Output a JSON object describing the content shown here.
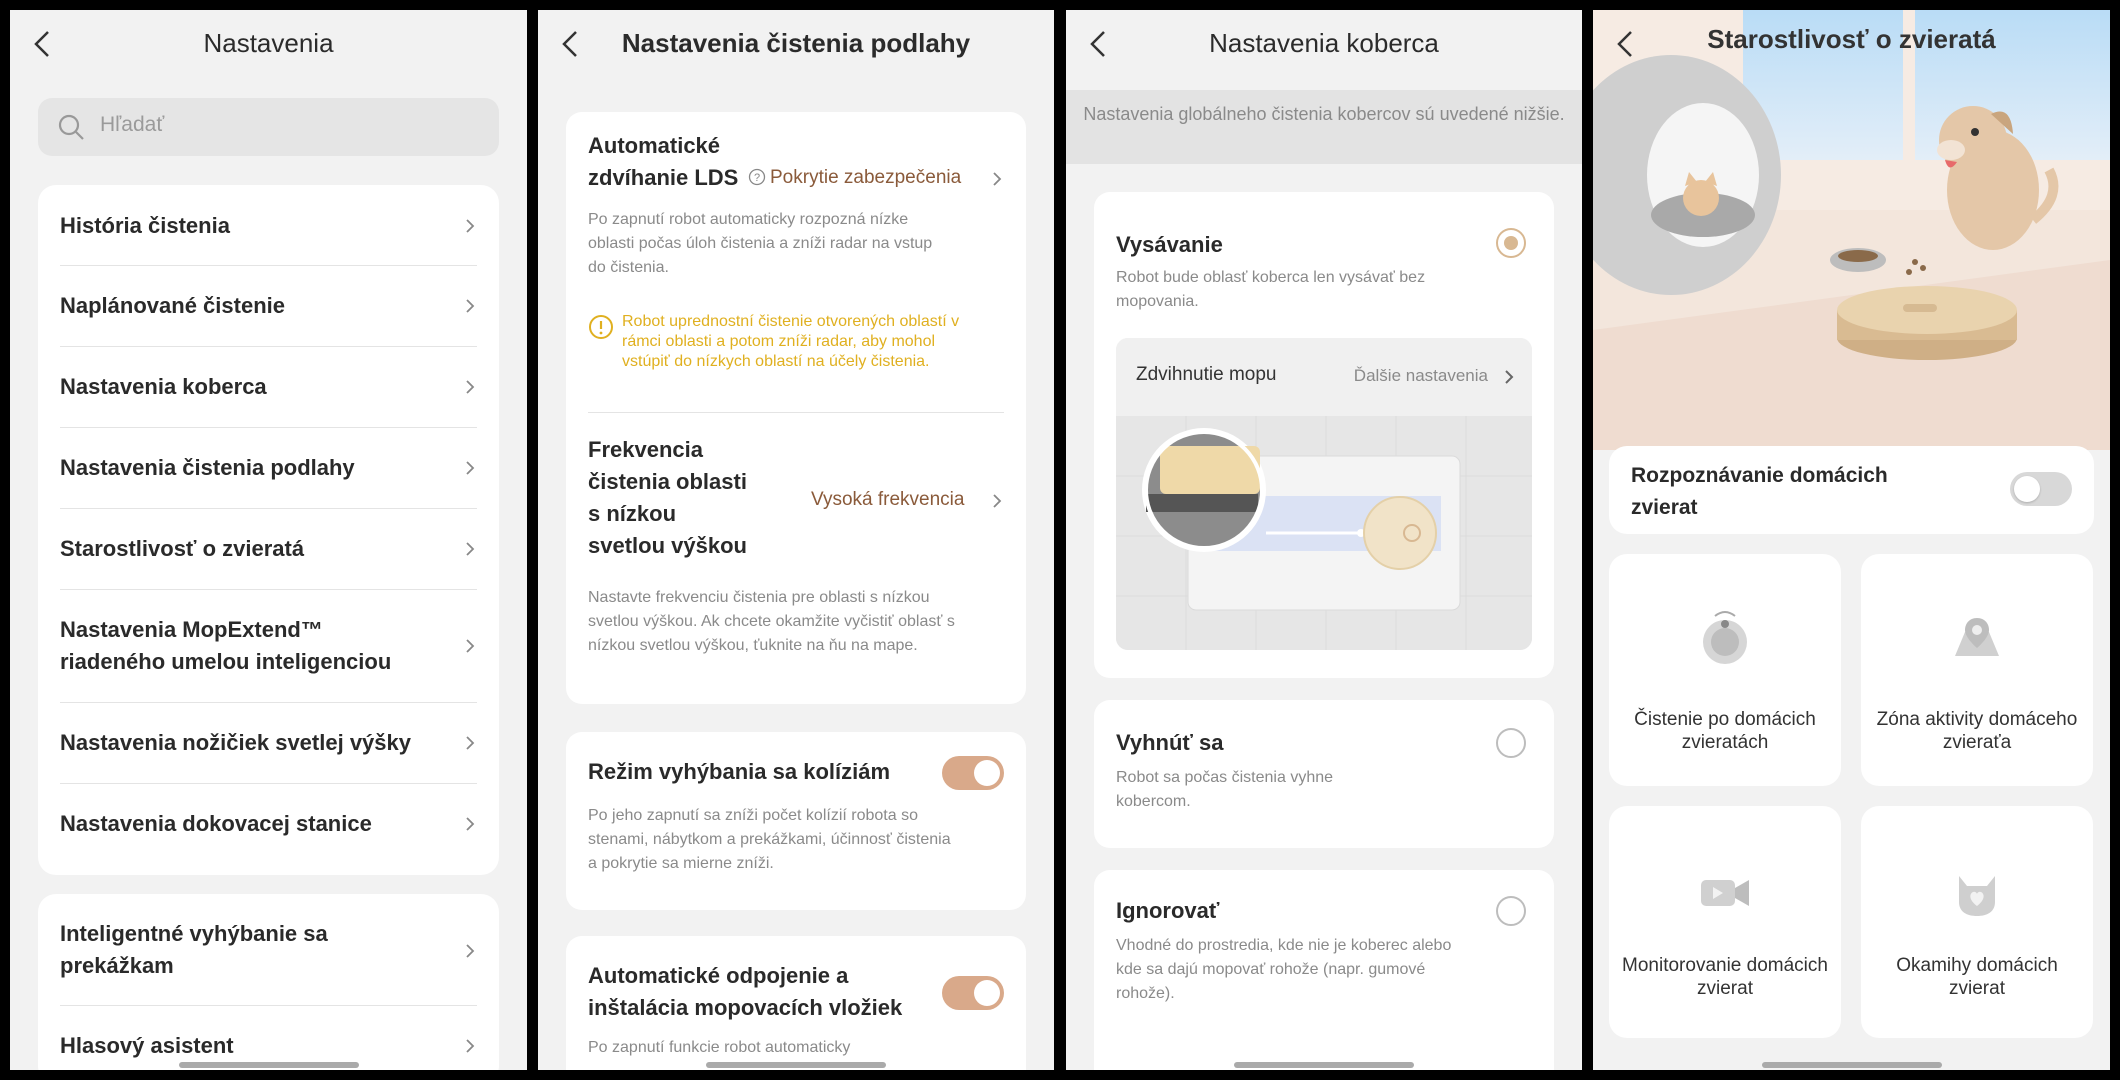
{
  "screen1": {
    "title": "Nastavenia",
    "search_placeholder": "Hľadať",
    "items": [
      {
        "label": "História čistenia"
      },
      {
        "label": "Naplánované čistenie"
      },
      {
        "label": "Nastavenia koberca"
      },
      {
        "label": "Nastavenia čistenia podlahy"
      },
      {
        "label": "Starostlivosť o zvieratá"
      },
      {
        "label": "Nastavenia MopExtend™ riadeného umelou inteligenciou"
      },
      {
        "label": "Nastavenia nožičiek svetlej výšky"
      },
      {
        "label": "Nastavenia dokovacej stanice"
      }
    ],
    "items2": [
      {
        "label": "Inteligentné vyhýbanie sa prekážkam"
      },
      {
        "label": "Hlasový asistent"
      }
    ]
  },
  "screen2": {
    "title": "Nastavenia čistenia podlahy",
    "lds": {
      "title": "Automatické zdvíhanie LDS",
      "value": "Pokrytie zabezpečenia",
      "desc": "Po zapnutí robot automaticky rozpozná nízke oblasti počas úloh čistenia a zníži radar na vstup do čistenia.",
      "warning": "Robot uprednostní čistenie otvorených oblastí v rámci oblasti a potom zníži radar, aby mohol vstúpiť do nízkych oblastí na účely čistenia."
    },
    "freq": {
      "title": "Frekvencia čistenia oblasti s nízkou svetlou výškou",
      "value": "Vysoká frekvencia",
      "desc": "Nastavte frekvenciu čistenia pre oblasti s nízkou svetlou výškou. Ak chcete okamžite vyčistiť oblasť s nízkou svetlou výškou, ťuknite na ňu na mape."
    },
    "collision": {
      "title": "Režim vyhýbania sa kolíziám",
      "desc": "Po jeho zapnutí sa zníži počet kolízií robota so stenami, nábytkom a prekážkami, účinnosť čistenia a pokrytie sa mierne zníži.",
      "enabled": true
    },
    "mop_pads": {
      "title": "Automatické odpojenie a inštalácia mopovacích vložiek",
      "desc": "Po zapnutí funkcie robot automaticky",
      "enabled": true
    }
  },
  "screen3": {
    "title": "Nastavenia koberca",
    "banner": "Nastavenia globálneho čistenia kobercov sú uvedené nižšie.",
    "options": [
      {
        "title": "Vysávanie",
        "desc": "Robot bude oblasť koberca len vysávať bez mopovania.",
        "selected": true
      },
      {
        "title": "Vyhnúť sa",
        "desc": "Robot sa počas čistenia vyhne kobercom.",
        "selected": false
      },
      {
        "title": "Ignorovať",
        "desc": "Vhodné do prostredia, kde nie je koberec alebo kde sa dajú mopovať rohože (napr. gumové rohože).",
        "selected": false
      }
    ],
    "mop_lift": {
      "label": "Zdvihnutie mopu",
      "more": "Ďalšie nastavenia"
    }
  },
  "screen4": {
    "title": "Starostlivosť o zvieratá",
    "pet_recognition": {
      "label": "Rozpoznávanie domácich zvierat",
      "enabled": false
    },
    "tiles": [
      {
        "label": "Čistenie po domácich zvieratách",
        "icon": "robot-icon"
      },
      {
        "label": "Zóna aktivity domáceho zvieraťa",
        "icon": "location-zone-icon"
      },
      {
        "label": "Monitorovanie domácich zvierat",
        "icon": "video-camera-icon"
      },
      {
        "label": "Okamihy domácich zvierat",
        "icon": "cat-heart-icon"
      }
    ]
  },
  "colors": {
    "accent": "#d9a98a",
    "warning": "#e0b020",
    "value_text": "#8a5a3a"
  }
}
